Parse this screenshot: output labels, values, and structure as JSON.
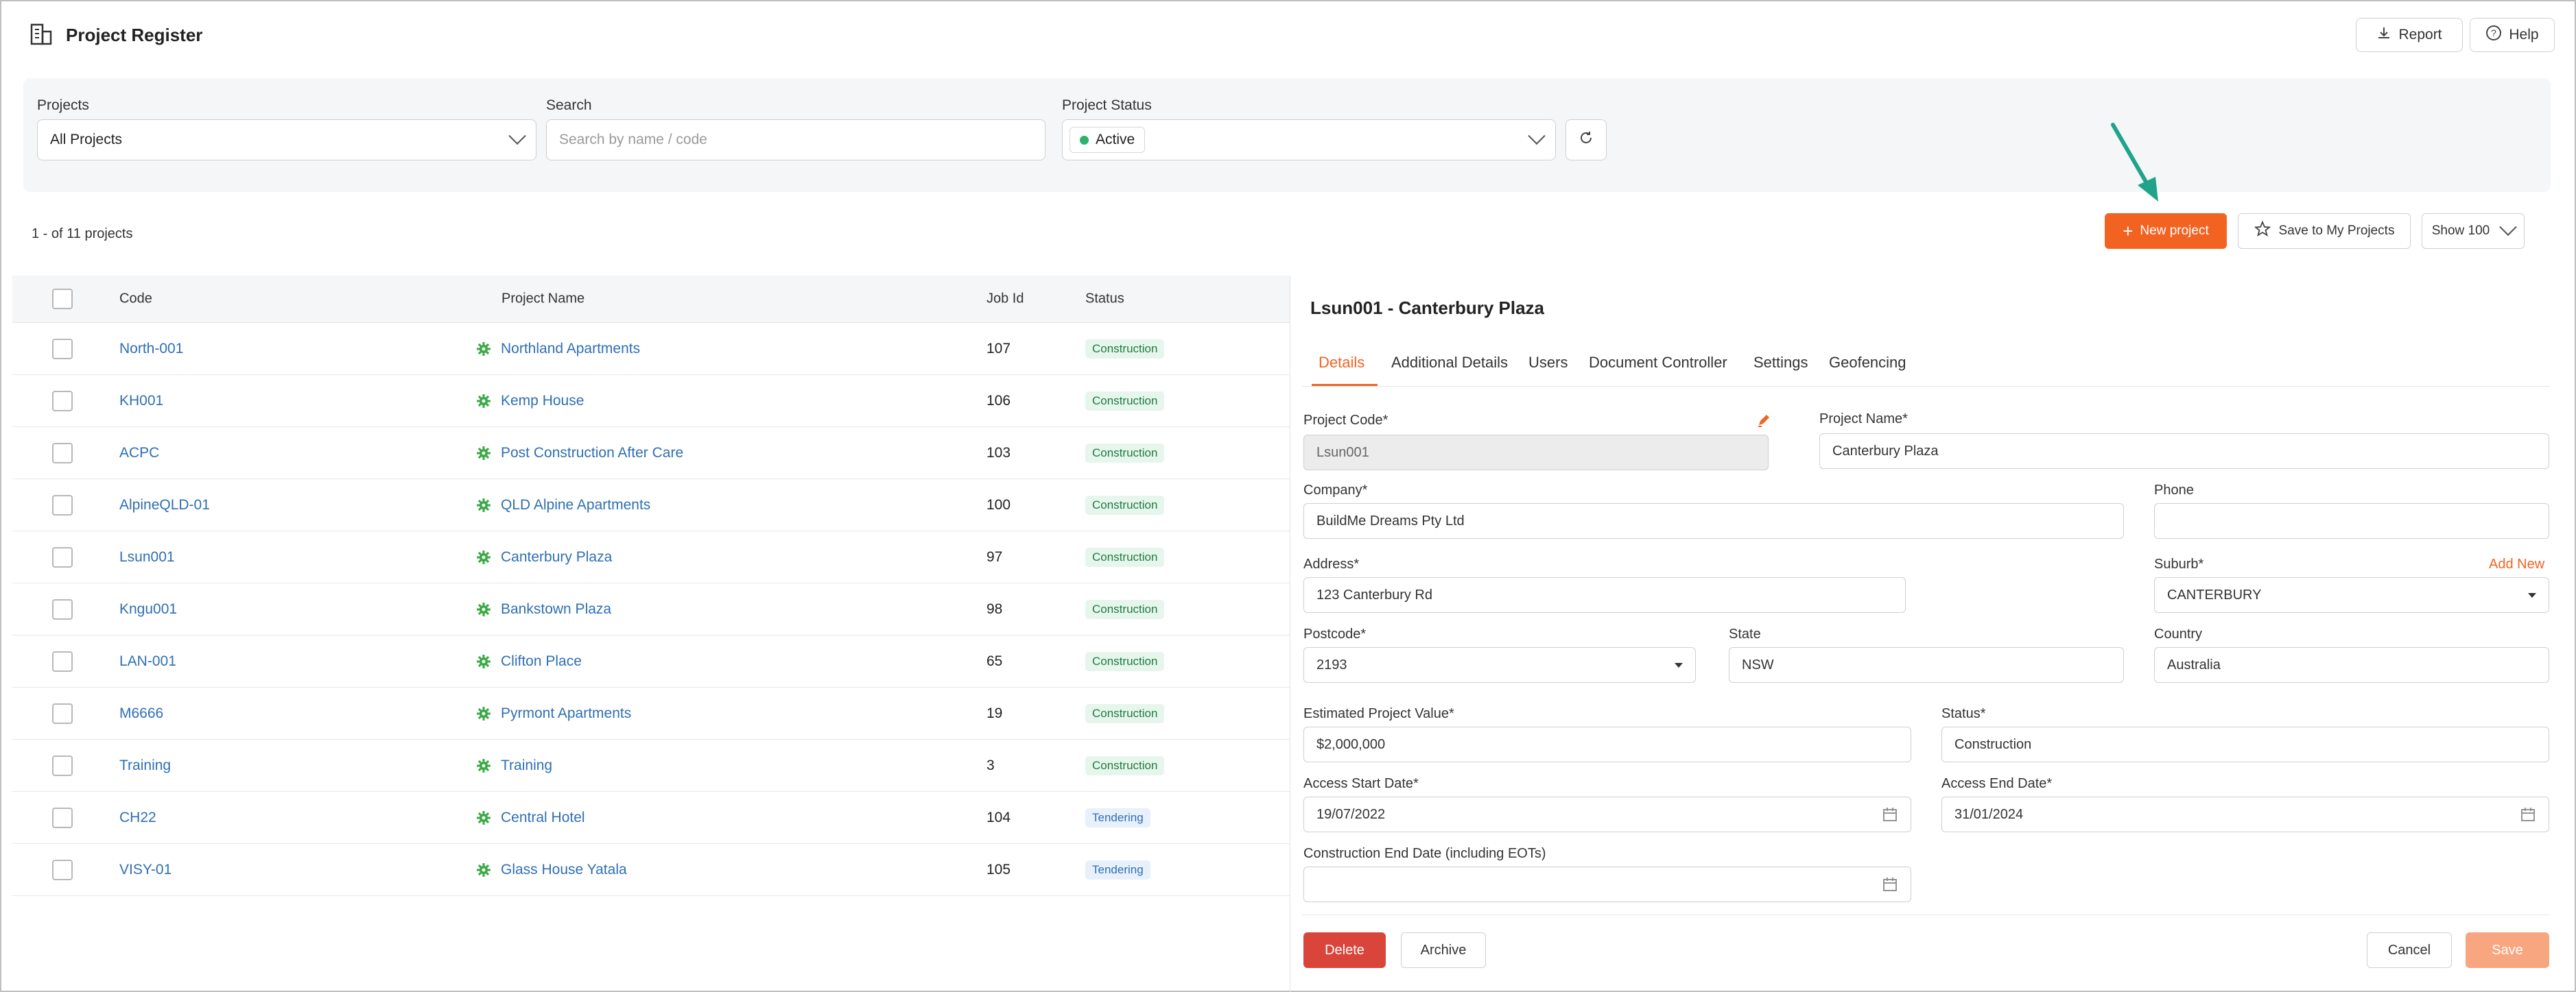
{
  "header": {
    "title": "Project Register",
    "report_label": "Report",
    "help_label": "Help"
  },
  "filters": {
    "projects_label": "Projects",
    "projects_value": "All Projects",
    "search_label": "Search",
    "search_placeholder": "Search by name / code",
    "status_label": "Project Status",
    "status_value": "Active"
  },
  "toolbar": {
    "count_text": "1 - of 11 projects",
    "new_project_label": "New project",
    "save_my_projects_label": "Save to My Projects",
    "show_label": "Show 100"
  },
  "table": {
    "columns": {
      "code": "Code",
      "name": "Project Name",
      "job_id": "Job Id",
      "status": "Status"
    },
    "rows": [
      {
        "code": "North-001",
        "name": "Northland Apartments",
        "job_id": "107",
        "status": "Construction"
      },
      {
        "code": "KH001",
        "name": "Kemp House",
        "job_id": "106",
        "status": "Construction"
      },
      {
        "code": "ACPC",
        "name": "Post Construction After Care",
        "job_id": "103",
        "status": "Construction"
      },
      {
        "code": "AlpineQLD-01",
        "name": "QLD Alpine Apartments",
        "job_id": "100",
        "status": "Construction"
      },
      {
        "code": "Lsun001",
        "name": "Canterbury Plaza",
        "job_id": "97",
        "status": "Construction"
      },
      {
        "code": "Kngu001",
        "name": "Bankstown Plaza",
        "job_id": "98",
        "status": "Construction"
      },
      {
        "code": "LAN-001",
        "name": "Clifton Place",
        "job_id": "65",
        "status": "Construction"
      },
      {
        "code": "M6666",
        "name": "Pyrmont Apartments",
        "job_id": "19",
        "status": "Construction"
      },
      {
        "code": "Training",
        "name": "Training",
        "job_id": "3",
        "status": "Construction"
      },
      {
        "code": "CH22",
        "name": "Central Hotel",
        "job_id": "104",
        "status": "Tendering"
      },
      {
        "code": "VISY-01",
        "name": "Glass House Yatala",
        "job_id": "105",
        "status": "Tendering"
      }
    ]
  },
  "detail": {
    "title": "Lsun001 - Canterbury Plaza",
    "tabs": [
      "Details",
      "Additional Details",
      "Users",
      "Document Controller",
      "Settings",
      "Geofencing"
    ],
    "fields": {
      "project_code_label": "Project Code*",
      "project_code": "Lsun001",
      "project_name_label": "Project Name*",
      "project_name": "Canterbury Plaza",
      "company_label": "Company*",
      "company": "BuildMe Dreams Pty Ltd",
      "phone_label": "Phone",
      "phone": "",
      "address_label": "Address*",
      "address": "123 Canterbury Rd",
      "suburb_label": "Suburb*",
      "suburb": "CANTERBURY",
      "add_new_label": "Add New",
      "postcode_label": "Postcode*",
      "postcode": "2193",
      "state_label": "State",
      "state": "NSW",
      "country_label": "Country",
      "country": "Australia",
      "est_value_label": "Estimated Project Value*",
      "est_value": "$2,000,000",
      "status_label": "Status*",
      "status": "Construction",
      "access_start_label": "Access Start Date*",
      "access_start": "19/07/2022",
      "access_end_label": "Access End Date*",
      "access_end": "31/01/2024",
      "construction_end_label": "Construction End Date (including EOTs)",
      "construction_end": ""
    },
    "buttons": {
      "delete": "Delete",
      "archive": "Archive",
      "cancel": "Cancel",
      "save": "Save"
    }
  },
  "colors": {
    "accent": "#f26322",
    "link": "#2e6fb3",
    "danger": "#d9443b",
    "arrow": "#1fa38a"
  }
}
